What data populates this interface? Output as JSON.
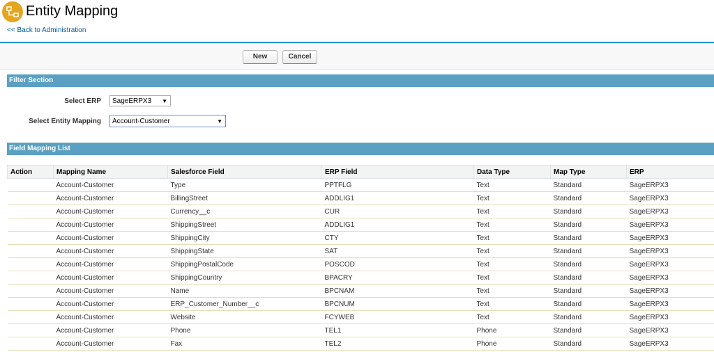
{
  "header": {
    "title": "Entity Mapping",
    "back_link": "<< Back to Administration",
    "icon": "entity-mapping-icon"
  },
  "buttons": {
    "new_label": "New",
    "cancel_label": "Cancel"
  },
  "filter": {
    "section_title": "Filter Section",
    "erp_label": "Select ERP",
    "erp_value": "SageERPX3",
    "entity_label": "Select Entity Mapping",
    "entity_value": "Account-Customer"
  },
  "mapping": {
    "section_title": "Field Mapping List",
    "columns": [
      "Action",
      "Mapping Name",
      "Salesforce Field",
      "ERP Field",
      "Data Type",
      "Map Type",
      "ERP"
    ],
    "rows": [
      [
        "",
        "Account-Customer",
        "Type",
        "PPTFLG",
        "Text",
        "Standard",
        "SageERPX3"
      ],
      [
        "",
        "Account-Customer",
        "BillingStreet",
        "ADDLIG1",
        "Text",
        "Standard",
        "SageERPX3"
      ],
      [
        "",
        "Account-Customer",
        "Currency__c",
        "CUR",
        "Text",
        "Standard",
        "SageERPX3"
      ],
      [
        "",
        "Account-Customer",
        "ShippingStreet",
        "ADDLIG1",
        "Text",
        "Standard",
        "SageERPX3"
      ],
      [
        "",
        "Account-Customer",
        "ShippingCity",
        "CTY",
        "Text",
        "Standard",
        "SageERPX3"
      ],
      [
        "",
        "Account-Customer",
        "ShippingState",
        "SAT",
        "Text",
        "Standard",
        "SageERPX3"
      ],
      [
        "",
        "Account-Customer",
        "ShippingPostalCode",
        "POSCOD",
        "Text",
        "Standard",
        "SageERPX3"
      ],
      [
        "",
        "Account-Customer",
        "ShippingCountry",
        "BPACRY",
        "Text",
        "Standard",
        "SageERPX3"
      ],
      [
        "",
        "Account-Customer",
        "Name",
        "BPCNAM",
        "Text",
        "Standard",
        "SageERPX3"
      ],
      [
        "",
        "Account-Customer",
        "ERP_Customer_Number__c",
        "BPCNUM",
        "Text",
        "Standard",
        "SageERPX3"
      ],
      [
        "",
        "Account-Customer",
        "Website",
        "FCYWEB",
        "Text",
        "Standard",
        "SageERPX3"
      ],
      [
        "",
        "Account-Customer",
        "Phone",
        "TEL1",
        "Phone",
        "Standard",
        "SageERPX3"
      ],
      [
        "",
        "Account-Customer",
        "Fax",
        "TEL2",
        "Phone",
        "Standard",
        "SageERPX3"
      ]
    ]
  },
  "colors": {
    "section_bar": "#5aa0c2",
    "header_rule": "#1797c0",
    "icon_bg": "#e4a61f",
    "link": "#015ba7"
  }
}
